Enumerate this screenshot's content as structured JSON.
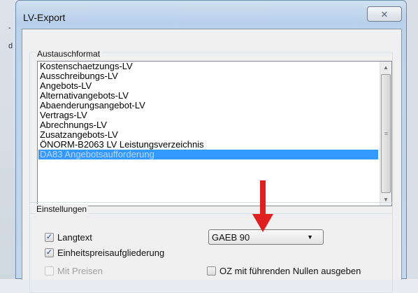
{
  "background": {
    "left_text": [
      "-",
      "d"
    ]
  },
  "window": {
    "title": "LV-Export",
    "close_glyph": "✕"
  },
  "format_group": {
    "label": "Austauschformat",
    "items": [
      "Kostenschaetzungs-LV",
      "Ausschreibungs-LV",
      "Angebots-LV",
      "Alternativangebots-LV",
      "Abaenderungsangebot-LV",
      "Vertrags-LV",
      "Abrechnungs-LV",
      "Zusatzangebots-LV",
      "ÖNORM-B2063 LV Leistungsverzeichnis",
      "DA83 Angebotsaufforderung"
    ],
    "selected_index": 9
  },
  "settings_group": {
    "label": "Einstellungen",
    "langtext": {
      "label": "Langtext",
      "checked": true
    },
    "einheitspreis": {
      "label": "Einheitspreisaufgliederung",
      "checked": true
    },
    "mit_preisen": {
      "label": "Mit Preisen",
      "checked": false,
      "disabled": true
    },
    "oz_nullen": {
      "label": "OZ mit führenden Nullen ausgeben",
      "checked": false
    },
    "format_combo": {
      "value": "GAEB 90"
    }
  },
  "icons": {
    "checkmark": "check-icon",
    "scroll_up": "triangle-up-icon",
    "scroll_down": "triangle-down-icon",
    "combo_arrow": "triangle-down-icon",
    "annotation": "red-arrow-down-icon"
  },
  "colors": {
    "selection": "#3399ff",
    "annotation_arrow": "#e02020",
    "title_bar": "#b9d1ea"
  }
}
